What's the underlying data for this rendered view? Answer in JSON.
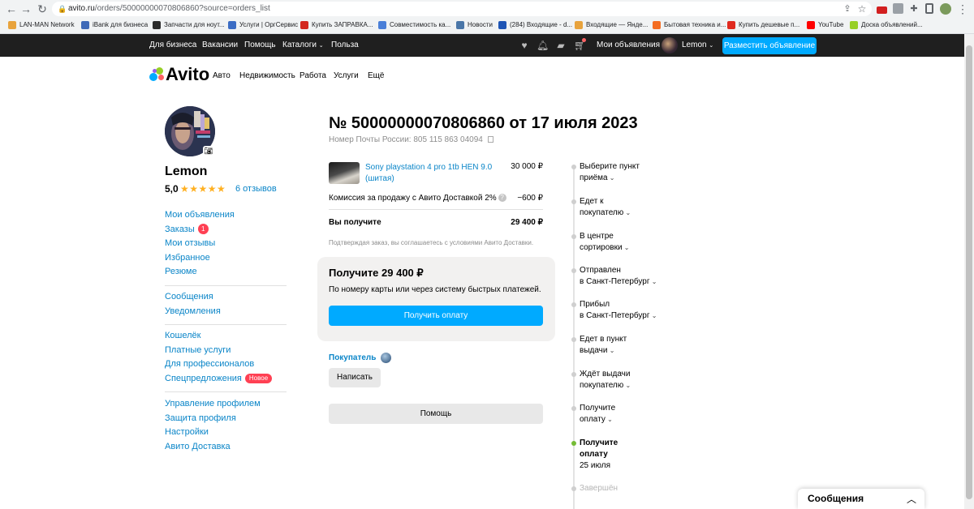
{
  "browser": {
    "url_host": "avito.ru",
    "url_path": "/orders/50000000070806860?source=orders_list",
    "bookmarks": [
      {
        "label": "LAN-MAN Network",
        "color": "#e8a33d"
      },
      {
        "label": "iBank для бизнеса",
        "color": "#3f6ab8"
      },
      {
        "label": "Запчасти для ноут...",
        "color": "#2b2b2b"
      },
      {
        "label": "Услуги | ОргСервис",
        "color": "#3b6cc4"
      },
      {
        "label": "Купить ЗАПРАВКА...",
        "color": "#d3271e"
      },
      {
        "label": "Совместимость ка...",
        "color": "#4a7fd8"
      },
      {
        "label": "Новости",
        "color": "#4a76a8"
      },
      {
        "label": "(284) Входящие - d...",
        "color": "#1e55b5"
      },
      {
        "label": "Входящие — Янде...",
        "color": "#e8a33d"
      },
      {
        "label": "Бытовая техника и...",
        "color": "#f46d22"
      },
      {
        "label": "Купить дешевые п...",
        "color": "#e02a1f"
      },
      {
        "label": "YouTube",
        "color": "#ff0000"
      },
      {
        "label": "Доска объявлений...",
        "color": "#97cf26"
      }
    ]
  },
  "topbar": {
    "for_business": "Для бизнеса",
    "vacancies": "Вакансии",
    "help": "Помощь",
    "catalogs": "Каталоги",
    "benefit": "Польза",
    "my_ads": "Мои объявления",
    "user": "Lemon",
    "post_ad": "Разместить объявление"
  },
  "site": {
    "logo": "Avito",
    "nav": [
      "Авто",
      "Недвижимость",
      "Работа",
      "Услуги",
      "Ещё"
    ]
  },
  "profile": {
    "name": "Lemon",
    "rating": "5,0",
    "stars": "★★★★★",
    "reviews": "6 отзывов",
    "group1": [
      "Мои объявления",
      "Заказы",
      "Мои отзывы",
      "Избранное",
      "Резюме"
    ],
    "orders_badge": "1",
    "group2": [
      "Сообщения",
      "Уведомления"
    ],
    "group3": [
      "Кошелёк",
      "Платные услуги",
      "Для профессионалов",
      "Спецпредложения"
    ],
    "new_badge": "Новое",
    "group4": [
      "Управление профилем",
      "Защита профиля",
      "Настройки",
      "Авито Доставка"
    ]
  },
  "order": {
    "title": "№ 50000000070806860 от 17 июля 2023",
    "tracking": "Номер Почты России: 805 115 863 04094",
    "item_name": "Sony playstation 4 pro 1tb HEN 9.0 (шитая)",
    "item_price": "30 000 ₽",
    "commission_label": "Комиссия за продажу с Авито Доставкой 2%",
    "commission_value": "−600 ₽",
    "receive_label": "Вы получите",
    "receive_value": "29 400 ₽",
    "agree_text": "Подтверждая заказ, вы соглашаетесь ",
    "agree_link": "с условиями Авито Доставки.",
    "pay_title": "Получите 29 400 ₽",
    "pay_sub": "По номеру карты или через систему быстрых платежей.",
    "pay_button": "Получить оплату",
    "buyer_label": "Покупатель",
    "write_button": "Написать",
    "help_button": "Помощь"
  },
  "timeline": [
    {
      "lines": [
        "Выберите пункт",
        "приёма"
      ],
      "chevron": true,
      "state": "done"
    },
    {
      "lines": [
        "Едет к",
        "покупателю"
      ],
      "chevron": true,
      "state": "done"
    },
    {
      "lines": [
        "В центре",
        "сортировки"
      ],
      "chevron": true,
      "state": "done"
    },
    {
      "lines": [
        "Отправлен",
        "в Санкт-Петербург"
      ],
      "chevron": true,
      "state": "done"
    },
    {
      "lines": [
        "Прибыл",
        "в Санкт-Петербург"
      ],
      "chevron": true,
      "state": "done"
    },
    {
      "lines": [
        "Едет в пункт",
        "выдачи"
      ],
      "chevron": true,
      "state": "done"
    },
    {
      "lines": [
        "Ждёт выдачи",
        "покупателю"
      ],
      "chevron": true,
      "state": "done"
    },
    {
      "lines": [
        "Получите",
        "оплату"
      ],
      "chevron": true,
      "state": "done"
    },
    {
      "lines": [
        "Получите",
        "оплату"
      ],
      "sub": "25 июля",
      "chevron": false,
      "state": "active"
    },
    {
      "lines": [
        "Завершён"
      ],
      "chevron": false,
      "state": "muted"
    }
  ],
  "messages_panel": {
    "title": "Сообщения"
  },
  "colors": {
    "accent": "#00aaff",
    "link": "#0a85c8",
    "badge": "#ff4053",
    "active_step": "#75bc35"
  }
}
